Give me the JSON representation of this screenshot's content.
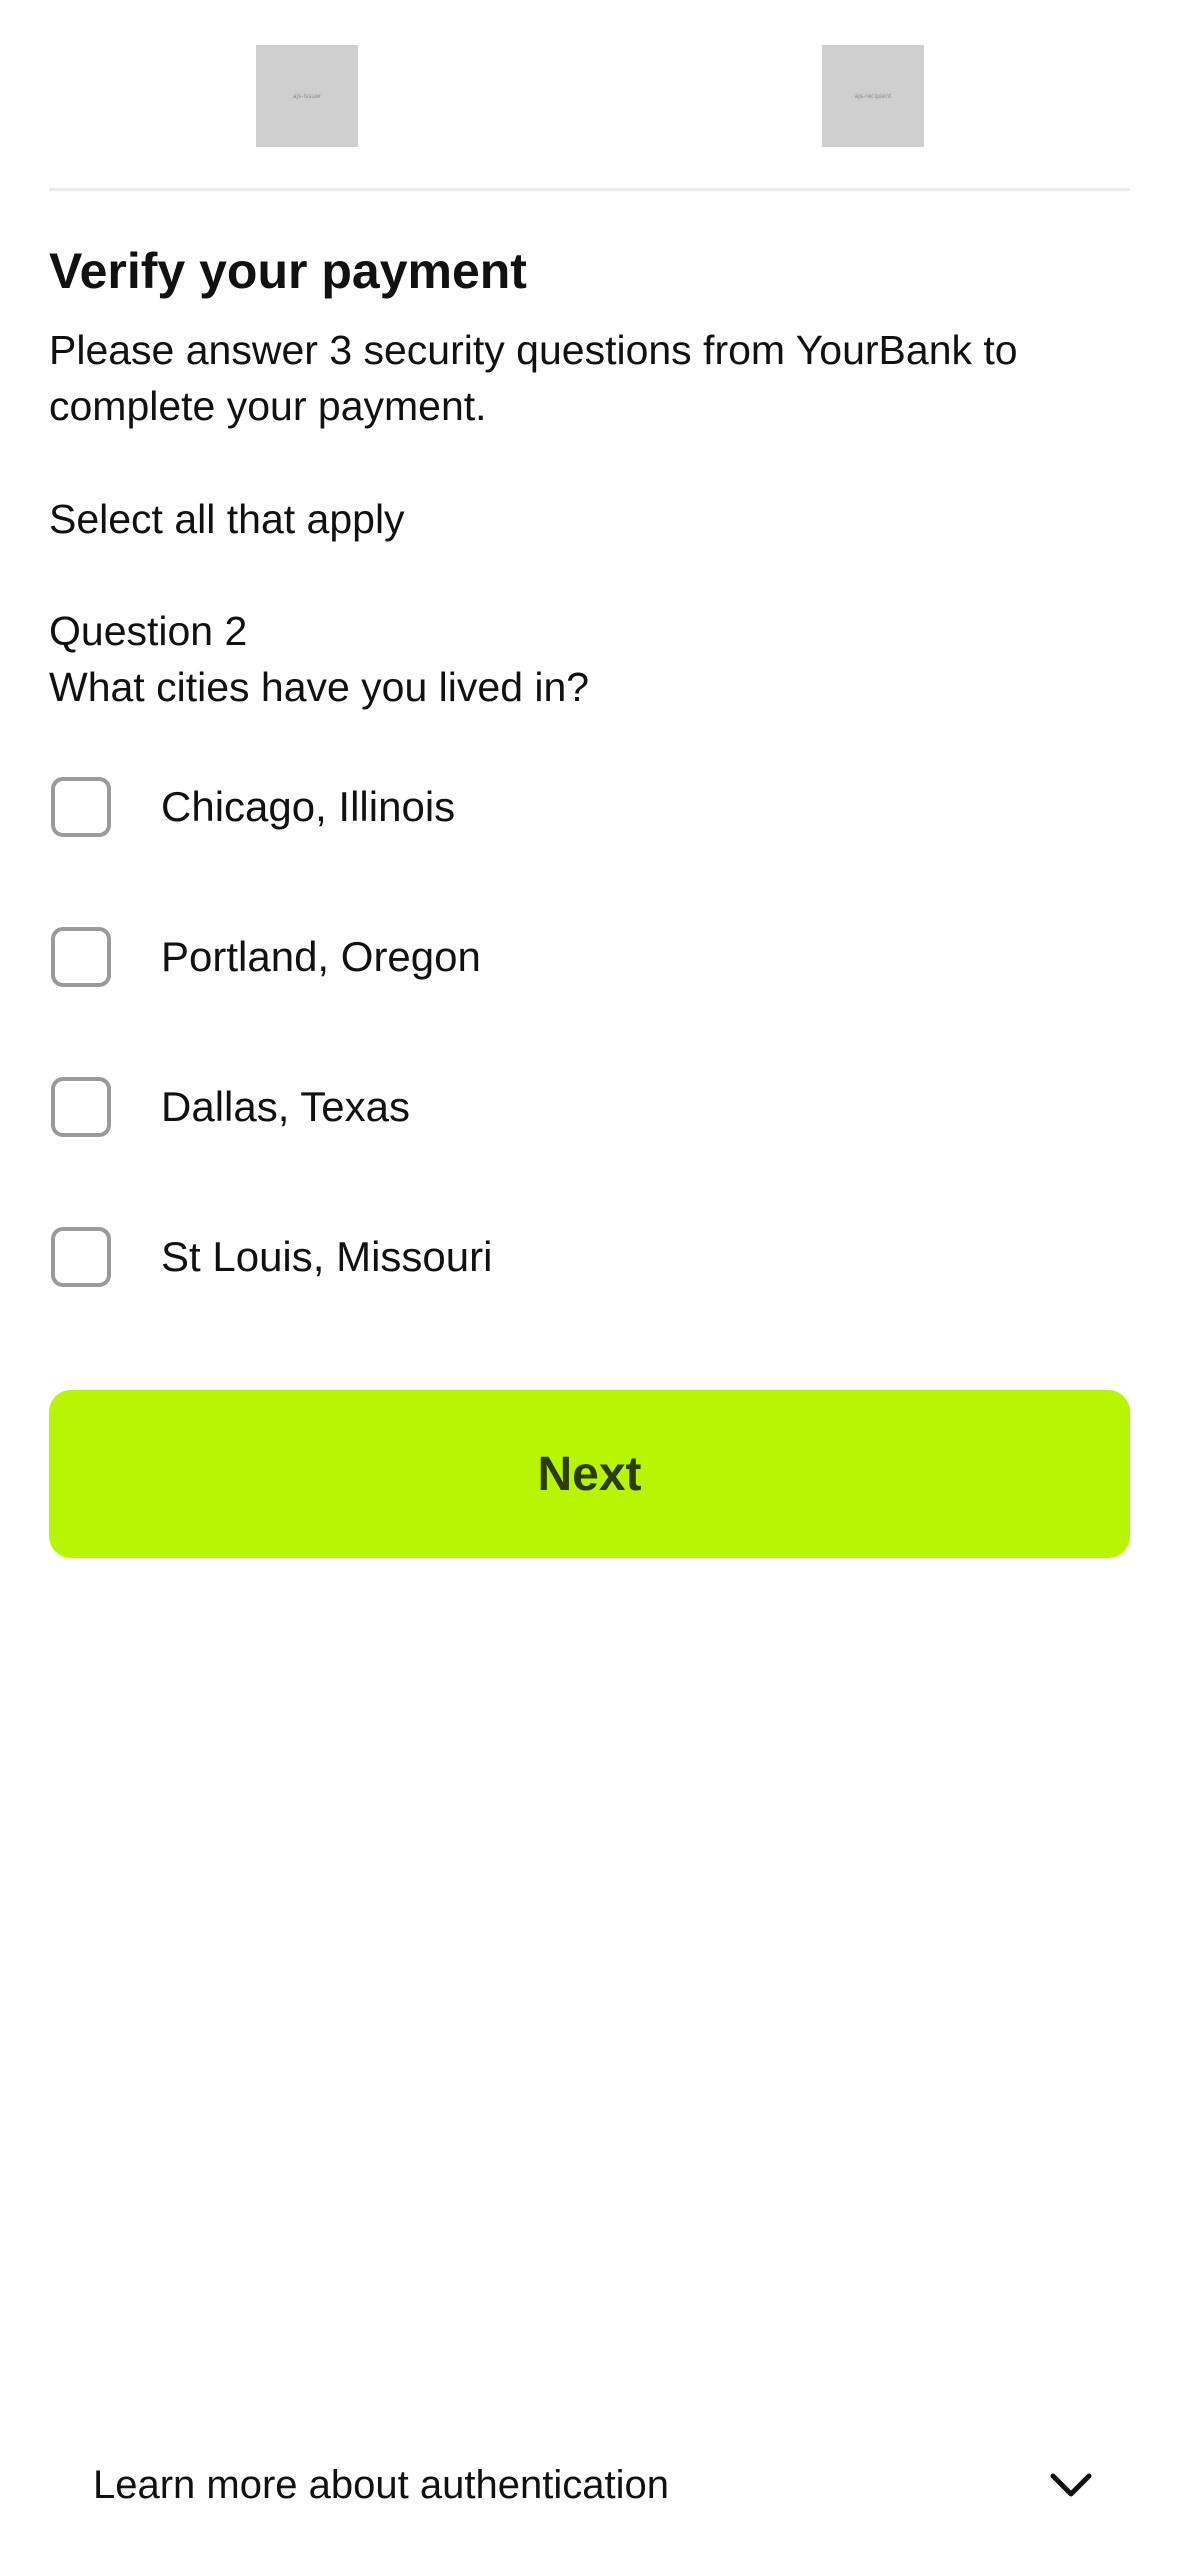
{
  "header": {
    "left_logo_text": "ajs-issuer",
    "right_logo_text": "ajs-recipient"
  },
  "main": {
    "title": "Verify your payment",
    "description": "Please answer 3 security questions from YourBank to complete your payment.",
    "instruction": "Select all that apply",
    "question_number": "Question 2",
    "question_text": "What cities have you lived in?",
    "options": [
      {
        "label": "Chicago, Illinois",
        "checked": false
      },
      {
        "label": "Portland, Oregon",
        "checked": false
      },
      {
        "label": "Dallas, Texas",
        "checked": false
      },
      {
        "label": "St Louis, Missouri",
        "checked": false
      }
    ],
    "next_label": "Next"
  },
  "footer": {
    "learn_more_label": "Learn more about authentication",
    "expand_icon": "chevron-down-icon"
  },
  "colors": {
    "accent": "#b8f502",
    "button_text": "#2c3d0d",
    "checkbox_border": "#9a9a9a"
  }
}
